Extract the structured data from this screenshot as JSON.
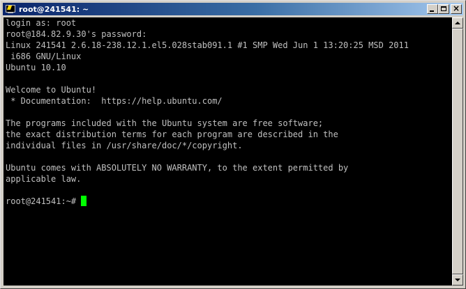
{
  "window": {
    "title": "root@241541: ~",
    "icon": "putty-terminal-icon",
    "buttons": {
      "minimize": "minimize-icon",
      "maximize": "maximize-icon",
      "close": "×"
    }
  },
  "terminal": {
    "background": "#000000",
    "foreground": "#c0c0c0",
    "cursor_color": "#00ff00",
    "lines": [
      "login as: root",
      "root@184.82.9.30's password:",
      "Linux 241541 2.6.18-238.12.1.el5.028stab091.1 #1 SMP Wed Jun 1 13:20:25 MSD 2011",
      " i686 GNU/Linux",
      "Ubuntu 10.10",
      "",
      "Welcome to Ubuntu!",
      " * Documentation:  https://help.ubuntu.com/",
      "",
      "The programs included with the Ubuntu system are free software;",
      "the exact distribution terms for each program are described in the",
      "individual files in /usr/share/doc/*/copyright.",
      "",
      "Ubuntu comes with ABSOLUTELY NO WARRANTY, to the extent permitted by",
      "applicable law.",
      "",
      "root@241541:~#"
    ]
  }
}
